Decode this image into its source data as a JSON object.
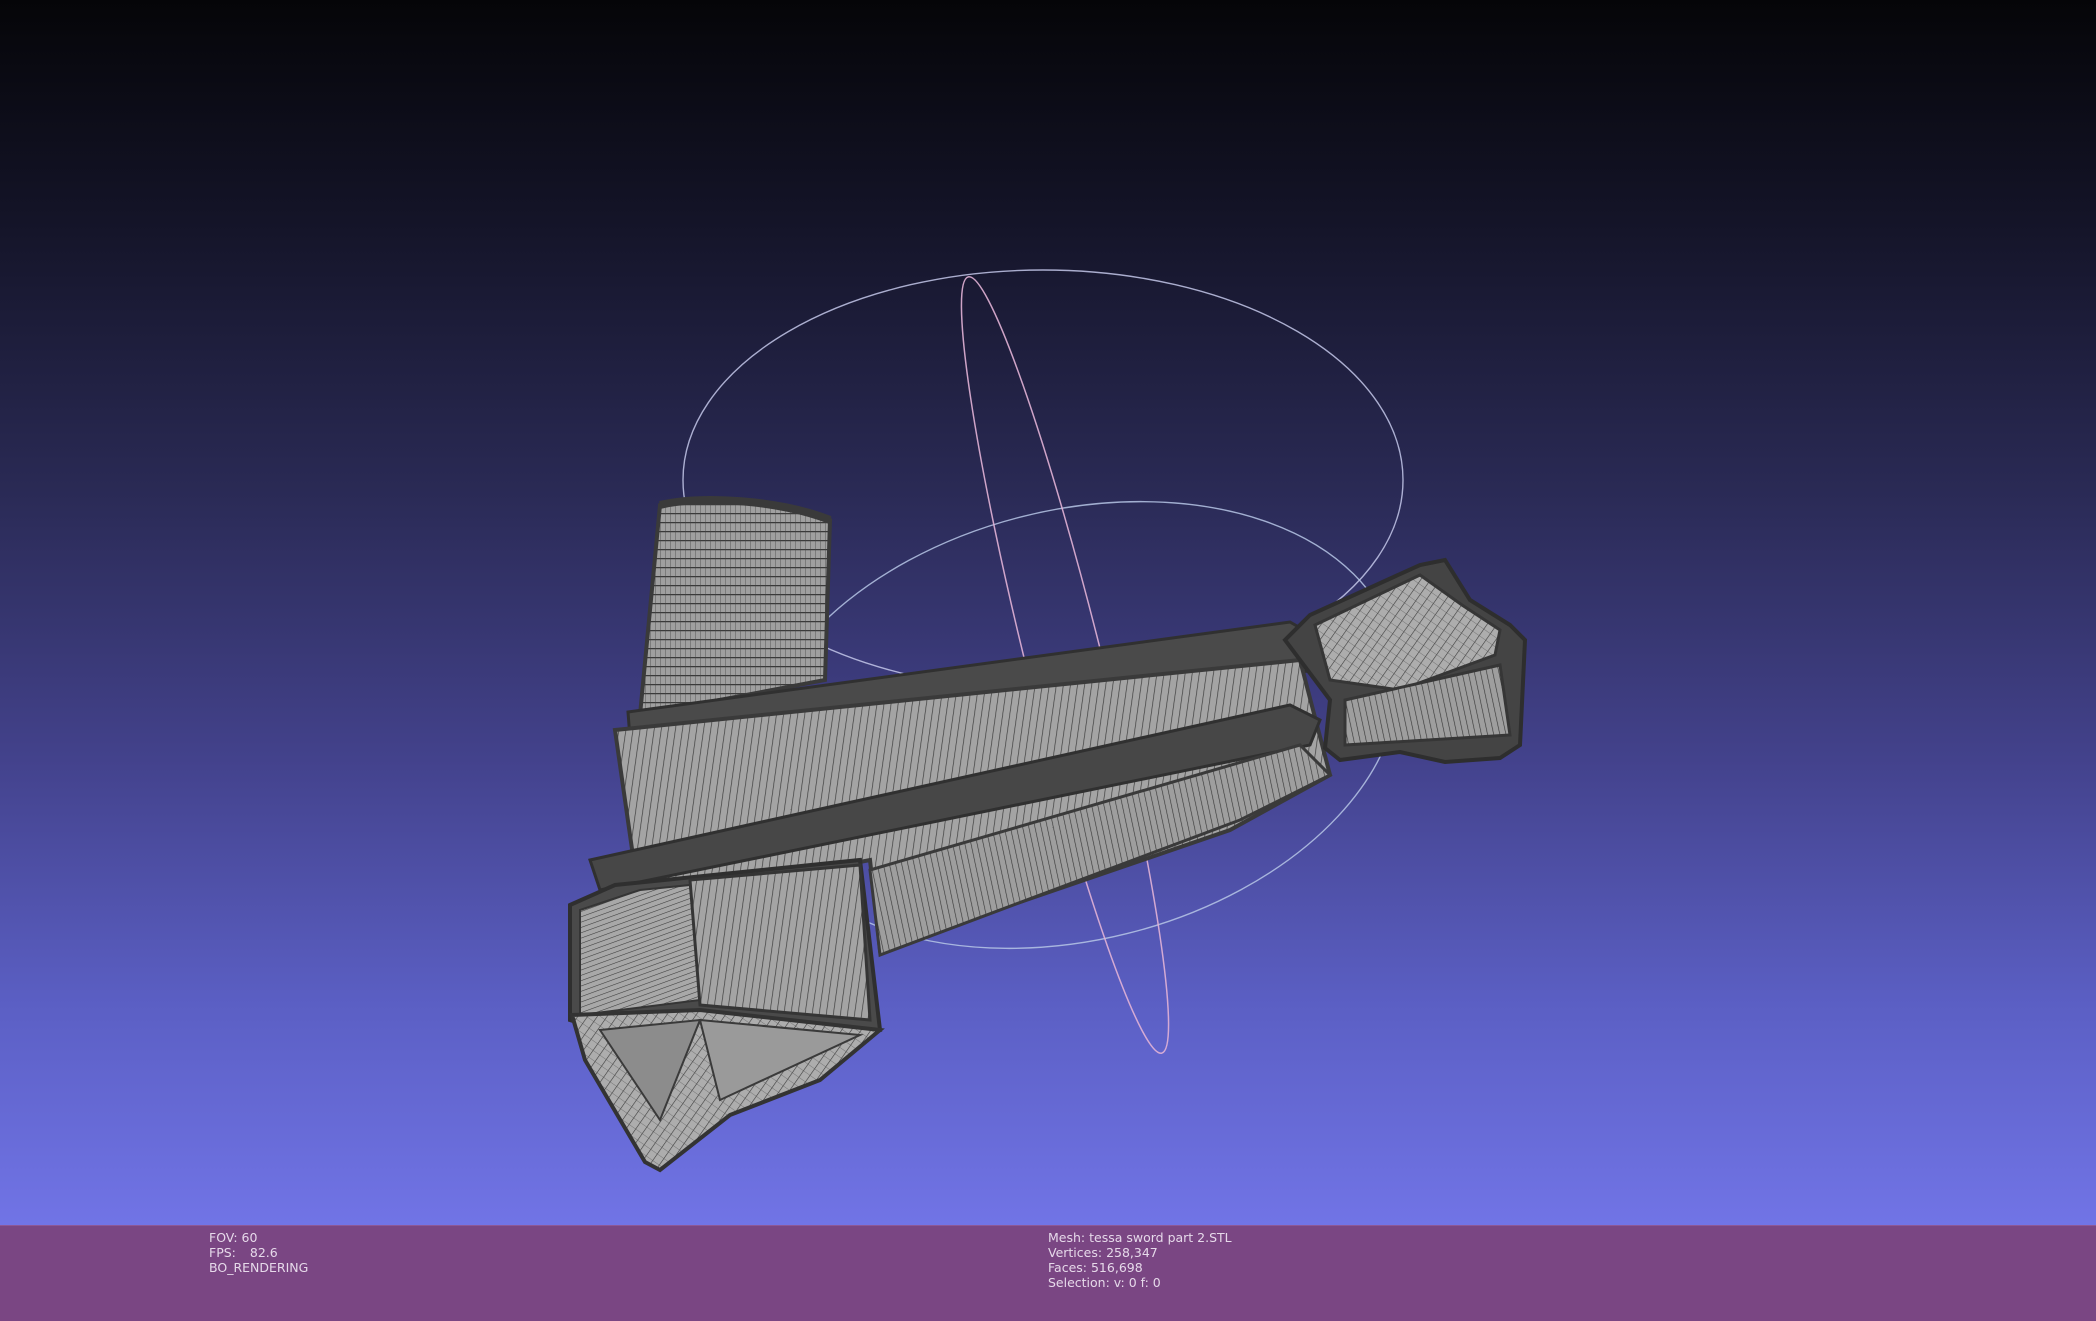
{
  "viewport": {
    "background_top": "#050508",
    "background_bottom": "#7174e6",
    "trackball_colors": {
      "horizontal": "#b7c7e6",
      "vertical": "#e2b2d6",
      "frontal": "#c4c8ea"
    },
    "mesh_color": "#9a9a9a",
    "wire_color": "#3e3e3e",
    "mesh_icon": "mesh-3d-model"
  },
  "info_left": {
    "fov_label": "FOV:",
    "fov_value": "60",
    "fps_label": "FPS:",
    "fps_value": "82.6",
    "render_mode": "BO_RENDERING"
  },
  "info_right": {
    "mesh_label": "Mesh:",
    "mesh_name": "tessa sword part 2.STL",
    "vertices_label": "Vertices:",
    "vertices_value": "258,347",
    "faces_label": "Faces:",
    "faces_value": "516,698",
    "selection_label": "Selection: v:",
    "selection_v": "0",
    "selection_f_label": "f:",
    "selection_f": "0"
  },
  "infobar_color": "#7a4683"
}
